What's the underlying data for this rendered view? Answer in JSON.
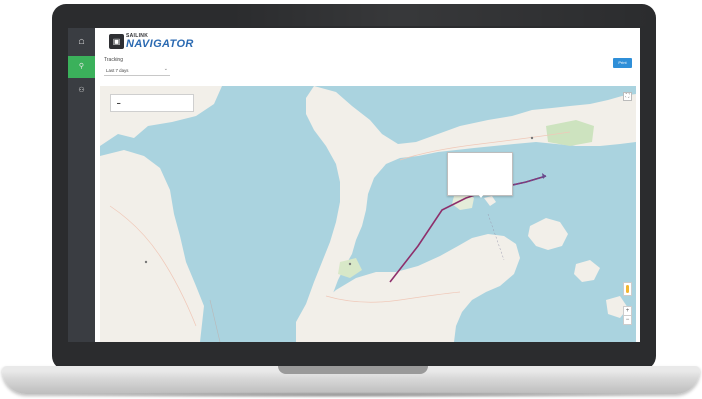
{
  "sidebar": {
    "items": [
      {
        "icon": "dashboard-icon",
        "label": "",
        "active": false
      },
      {
        "icon": "location-pin-icon",
        "label": "",
        "active": true
      },
      {
        "icon": "user-icon",
        "label": "",
        "active": false
      }
    ]
  },
  "header": {
    "logo_top": "SAILINK",
    "logo_main": "NAVIGATOR",
    "user_name": "",
    "user_org": ""
  },
  "page": {
    "title": "Tracking",
    "range_select": "Last 7 days",
    "export_label": "Print"
  },
  "map": {
    "legend_line_1": "",
    "legend_line_2": "",
    "popup_lines": [
      "",
      "",
      "",
      "",
      "",
      ""
    ],
    "attribution": "",
    "track_color": "#8e2f6b"
  },
  "colors": {
    "accent": "#2f8fd8",
    "active_nav": "#3bb15b",
    "water": "#aad3df",
    "land": "#f2efe9"
  }
}
